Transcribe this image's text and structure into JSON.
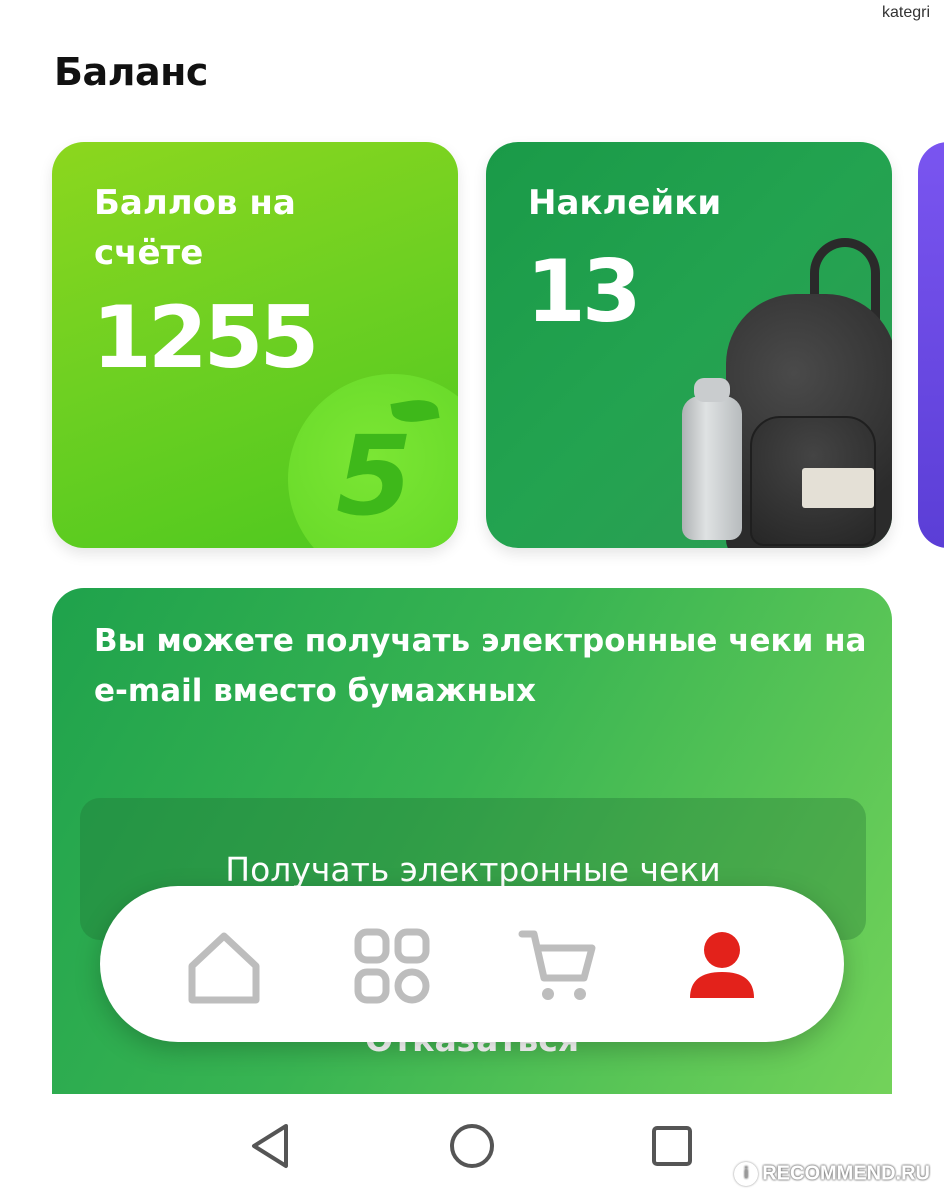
{
  "watermark_top": "kategri",
  "page": {
    "title": "Баланс"
  },
  "cards": {
    "points": {
      "label": "Баллов на счёте",
      "value": "1255",
      "logo_glyph": "5"
    },
    "stickers": {
      "label": "Наклейки",
      "value": "13"
    }
  },
  "promo": {
    "text": "Вы можете получать электронные чеки на e-mail вместо бумажных",
    "button_label": "Получать электронные чеки",
    "decline_label": "Отказаться"
  },
  "tabbar": {
    "items": [
      {
        "icon": "home-icon",
        "active": false
      },
      {
        "icon": "catalog-grid-icon",
        "active": false
      },
      {
        "icon": "cart-icon",
        "active": false
      },
      {
        "icon": "profile-icon",
        "active": true
      }
    ],
    "active_color": "#e3221b",
    "inactive_color": "#bdbdbd"
  },
  "system_nav": [
    "back-icon",
    "home-circle-icon",
    "recents-icon"
  ],
  "watermark_bottom": "RECOMMEND.RU",
  "watermark_bottom_mark": "i",
  "colors": {
    "points_card": "#6fd022",
    "stickers_card": "#1a9a48",
    "promo": "#38b452"
  }
}
